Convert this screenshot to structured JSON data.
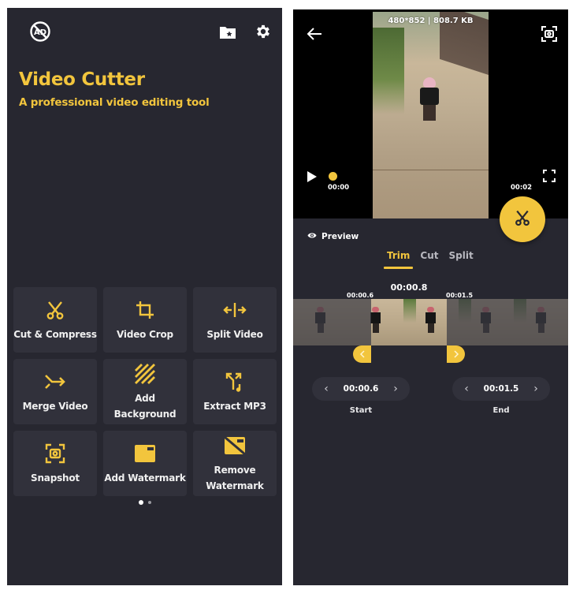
{
  "home": {
    "title": "Video Cutter",
    "subtitle": "A professional video editing tool",
    "top_icons": [
      "no-ads-icon",
      "favorite-folder-icon",
      "gear-icon"
    ],
    "tools": [
      {
        "label": "Cut & Compress",
        "icon": "scissors-icon"
      },
      {
        "label": "Video Crop",
        "icon": "crop-icon"
      },
      {
        "label": "Split Video",
        "icon": "split-icon"
      },
      {
        "label": "Merge Video",
        "icon": "merge-icon"
      },
      {
        "label": "Add Background",
        "icon": "background-pattern-icon"
      },
      {
        "label": "Extract MP3",
        "icon": "extract-audio-icon"
      },
      {
        "label": "Snapshot",
        "icon": "snapshot-icon"
      },
      {
        "label": "Add Watermark",
        "icon": "watermark-icon"
      },
      {
        "label": "Remove Watermark",
        "icon": "remove-watermark-icon"
      }
    ],
    "page_indicator": {
      "pages": 2,
      "current": 1
    }
  },
  "editor": {
    "video_info": "480*852 | 808.7 KB",
    "current_time": "00:00",
    "total_time": "00:02",
    "preview_label": "Preview",
    "tabs": [
      {
        "label": "Trim",
        "active": true
      },
      {
        "label": "Cut",
        "active": false
      },
      {
        "label": "Split",
        "active": false
      }
    ],
    "selection_duration": "00:00.8",
    "marker_start": "00:00.6",
    "marker_end": "00:01.5",
    "start": {
      "value": "00:00.6",
      "label": "Start"
    },
    "end": {
      "value": "00:01.5",
      "label": "End"
    },
    "stepper_prev": "‹",
    "stepper_next": "›",
    "colors": {
      "accent": "#f2c53d",
      "background": "#272730",
      "tile": "#31313b"
    }
  }
}
